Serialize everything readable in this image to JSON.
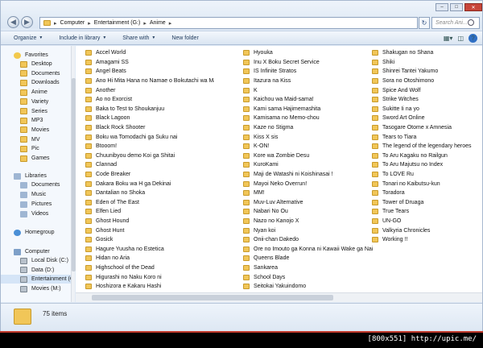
{
  "address": {
    "crumbs": [
      "Computer",
      "Entertainment (G:)",
      "Anime"
    ],
    "search_placeholder": "Search Ani..."
  },
  "toolbar": {
    "organize": "Organize",
    "include_in_library": "Include in library",
    "share_with": "Share with",
    "new_folder": "New folder"
  },
  "nav": {
    "favorites": "Favorites",
    "favorites_items": [
      "Desktop",
      "Documents",
      "Downloads",
      "Anime",
      "Variety",
      "Series",
      "MP3",
      "Movies",
      "MV",
      "Pic",
      "Games"
    ],
    "libraries": "Libraries",
    "libraries_items": [
      "Documents",
      "Music",
      "Pictures",
      "Videos"
    ],
    "homegroup": "Homegroup",
    "computer": "Computer",
    "computer_items": [
      "Local Disk (C:)",
      "Data (D:)",
      "Entertainment (G",
      "Movies (M:)"
    ]
  },
  "files": {
    "col1": [
      "Accel World",
      "Amagami SS",
      "Angel Beats",
      "Ano Hi Mita Hana no Namae o Bokutachi wa Mada Shiranai",
      "Another",
      "Ao no Exorcist",
      "Baka to Test to Shoukanjuu",
      "Black Lagoon",
      "Black Rock Shooter",
      "Boku wa Tomodachi ga Suku nai",
      "Btooom!",
      "Chuunibyou demo Koi ga Shitai",
      "Clannad",
      "Code Breaker",
      "Dakara Boku wa H ga Dekinai",
      "Dantalian no Shoka",
      "Eden of The East",
      "Elfen Lied",
      "Ghost Hound",
      "Ghost Hunt",
      "Gosick",
      "Hagure Yuusha no Estetica",
      "Hidan no Aria",
      "Highschool of the Dead",
      "Higurashi no Naku Koro ni",
      "Hoshizora e Kakaru Hashi",
      "Hyakka Ryouran Samurai Girls"
    ],
    "col2": [
      "Hyouka",
      "Inu X Boku Secret Service",
      "IS Infinite Stratos",
      "Itazura na Kiss",
      "K",
      "Kaichou wa Maid-sama!",
      "Kami sama Hajimemashita",
      "Kamisama no Memo-chou",
      "Kaze no Stigma",
      "Kiss X sis",
      "K-ON!",
      "Kore wa Zombie Desu",
      "KuroKami",
      "Maji de Watashi ni Koishinasai !",
      "Mayoi Neko Overrun!",
      "MM!",
      "Muv-Luv Alternative",
      "Nabari No Ou",
      "Nazo no Kanojo X",
      "Nyan koi",
      "Onii-chan Dakedo",
      "Ore no Imouto ga Konna ni Kawaii Wake ga Nai",
      "Queens Blade",
      "Sankarea",
      "School Days",
      "Seitokai Yakuindomo",
      "Seto no Hanayome"
    ],
    "col3": [
      "Shakugan no Shana",
      "Shiki",
      "Shinrei Tantei Yakumo",
      "Sora no Otoshimono",
      "Spice And Wolf",
      "Strike Witches",
      "Sukitte Ii na yo",
      "Sword Art Online",
      "Tasogare Otome x Amnesia",
      "Tears to Tiara",
      "The legend of the legendary heroes",
      "To Aru Kagaku no Railgun",
      "To Aru Majutsu no Index",
      "To LOVE Ru",
      "Tonari no Kaibutsu-kun",
      "Toradora",
      "Tower of Druaga",
      "True Tears",
      "UN-GO",
      "Valkyria Chronicles",
      "Working !!"
    ]
  },
  "details": {
    "count": "75 items"
  },
  "watermark": "[800x551] http://upic.me/",
  "colors": {
    "folder": "#f1c658",
    "accent": "#1e395b",
    "selection": "#d5e5f7"
  }
}
